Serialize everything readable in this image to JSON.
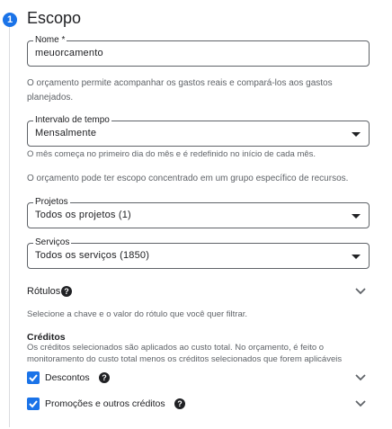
{
  "step": {
    "number": "1",
    "title": "Escopo"
  },
  "name_field": {
    "label": "Nome *",
    "value": "meuorcamento"
  },
  "name_help": "O orçamento permite acompanhar os gastos reais e compará-los aos gastos planejados.",
  "interval_field": {
    "label": "Intervalo de tempo",
    "value": "Mensalmente",
    "help": "O mês começa no primeiro dia do mês e é redefinido no início de cada mês."
  },
  "scope_help": "O orçamento pode ter escopo concentrado em um grupo específico de recursos.",
  "projects_field": {
    "label": "Projetos",
    "value": "Todos os projetos (1)"
  },
  "services_field": {
    "label": "Serviços",
    "value": "Todos os serviços (1850)"
  },
  "labels_section": {
    "title": "Rótulos",
    "help_icon": "question-icon",
    "description": "Selecione a chave e o valor do rótulo que você quer filtrar."
  },
  "credits_section": {
    "title": "Créditos",
    "description": "Os créditos selecionados são aplicados ao custo total. No orçamento, é feito o monitoramento do custo total menos os créditos selecionados que forem aplicáveis",
    "items": [
      {
        "label": "Descontos",
        "checked": true
      },
      {
        "label": "Promoções e outros créditos",
        "checked": true
      }
    ]
  },
  "colors": {
    "accent": "#1a73e8",
    "text": "#202124",
    "muted": "#5f6368"
  }
}
